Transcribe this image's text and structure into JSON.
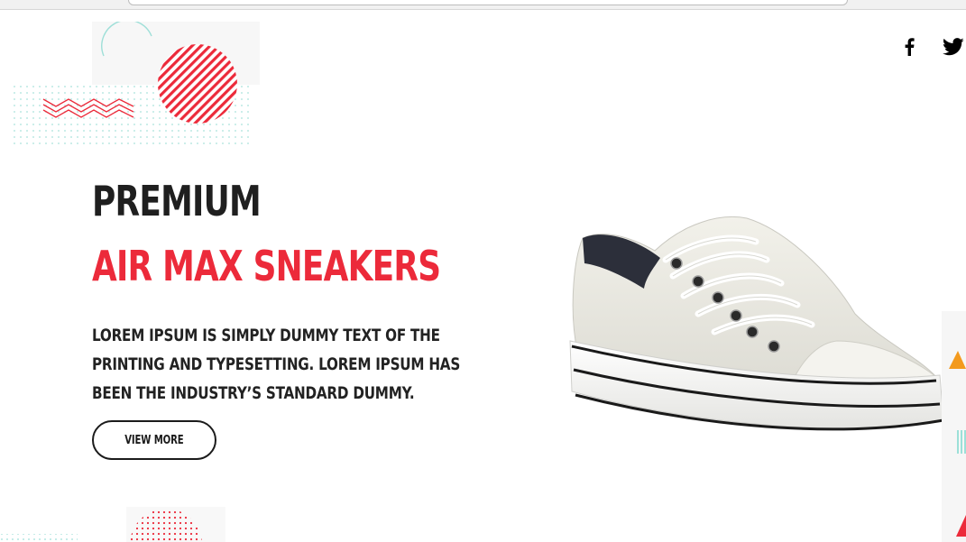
{
  "hero": {
    "line1": "PREMIUM",
    "line2": "AIR MAX SNEAKERS",
    "description": "LOREM IPSUM IS SIMPLY DUMMY TEXT OF THE PRINTING AND TYPESETTING. LOREM IPSUM HAS BEEN THE INDUSTRY’S STANDARD DUMMY.",
    "button_label": "VIEW MORE"
  },
  "social": {
    "facebook_icon": "facebook-icon",
    "twitter_icon": "twitter-icon"
  },
  "colors": {
    "accent": "#ec2a3a",
    "text_dark": "#1f1f1f",
    "deco_teal": "#7fd8cf",
    "deco_orange": "#f39a1d"
  }
}
